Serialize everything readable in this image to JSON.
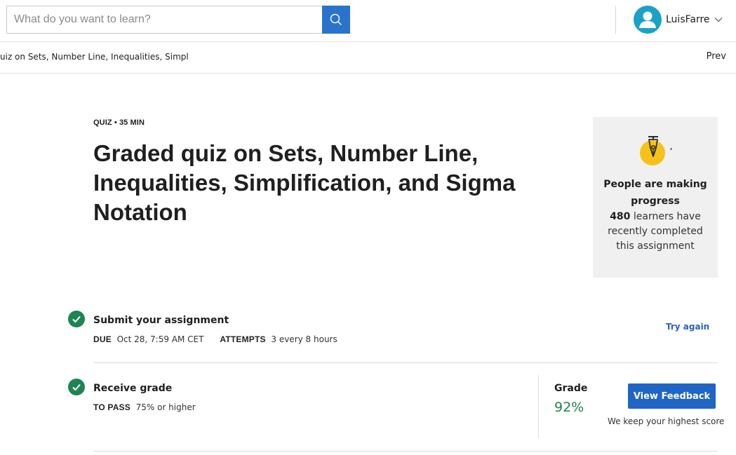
{
  "header": {
    "search_placeholder": "What do you want to learn?",
    "search_icon": "search-icon",
    "user": {
      "name": "LuisFarre",
      "avatar_icon": "user-icon",
      "chevron_icon": "chevron-down-icon"
    }
  },
  "breadcrumb": {
    "text": "uiz on Sets, Number Line, Inequalities, Simpl",
    "prev_label": "Prev"
  },
  "quiz": {
    "meta": "QUIZ • 35 MIN",
    "title": "Graded quiz on Sets, Number Line, Inequalities, Simplification, and Sigma Notation"
  },
  "progress_card": {
    "icon": "pen-badge-icon",
    "title": "People are making progress",
    "count": "480",
    "body": " learners have recently completed this assignment"
  },
  "submit": {
    "title": "Submit your assignment",
    "due_label": "DUE",
    "due_value": "Oct 28, 7:59 AM CET",
    "attempts_label": "ATTEMPTS",
    "attempts_value": "3 every 8 hours",
    "try_again_label": "Try again",
    "status_icon": "check-icon"
  },
  "grade": {
    "title": "Receive grade",
    "to_pass_label": "TO PASS",
    "to_pass_value": "75% or higher",
    "grade_label": "Grade",
    "grade_value": "92%",
    "feedback_button": "View Feedback",
    "note": "We keep your highest score",
    "status_icon": "check-icon"
  },
  "colors": {
    "primary_blue": "#2065c5",
    "link_blue": "#2a62b8",
    "success_green": "#1f8354",
    "avatar_teal": "#1aa1c8",
    "card_bg": "#f0f0f0"
  }
}
